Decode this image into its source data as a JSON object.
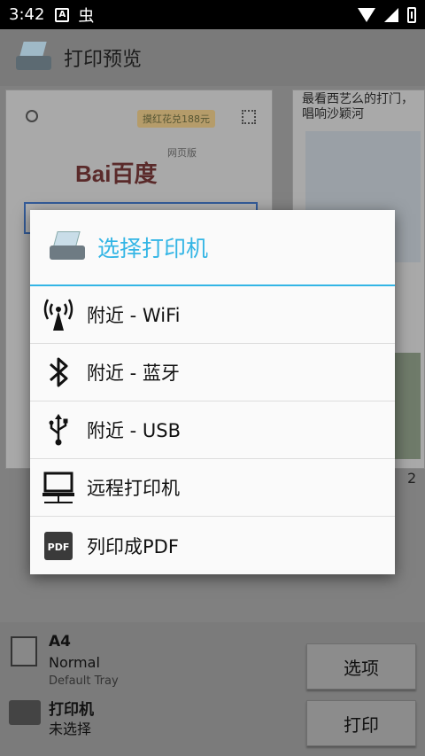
{
  "status_bar": {
    "time": "3:42",
    "left_icon_text": "A",
    "bug_icon_text": "虫"
  },
  "app_bar": {
    "title": "打印预览"
  },
  "preview": {
    "card1": {
      "promo": "摸红花兑188元",
      "logo": "Bai百度",
      "logo_sub": "网页版"
    },
    "card2": {
      "news_title": "最看西艺么的打门，唱响沙颖河"
    },
    "page_number": "2"
  },
  "bottom": {
    "paper_size": "A4",
    "paper_type": "Normal",
    "paper_tray": "Default Tray",
    "printer_label": "打印机",
    "printer_status": "未选择",
    "options_button": "选项",
    "print_button": "打印"
  },
  "dialog": {
    "title": "选择打印机",
    "items": [
      {
        "label": "附近 - WiFi",
        "icon": "wifi-antenna-icon"
      },
      {
        "label": "附近 - 蓝牙",
        "icon": "bluetooth-icon"
      },
      {
        "label": "附近 - USB",
        "icon": "usb-icon"
      },
      {
        "label": "远程打印机",
        "icon": "remote-computer-icon"
      },
      {
        "label": "列印成PDF",
        "icon": "pdf-icon"
      }
    ]
  },
  "colors": {
    "accent": "#33b5e5",
    "dialog_bg": "#fafafa",
    "scrim": "#808080"
  }
}
